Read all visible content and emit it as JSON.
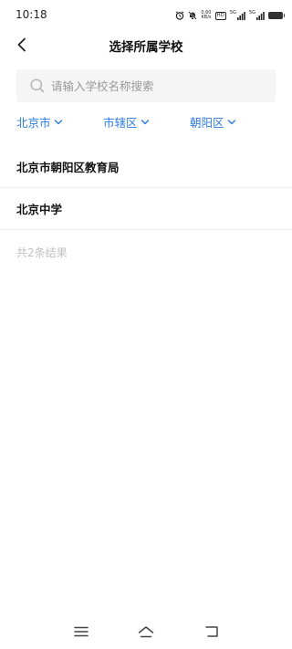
{
  "status_bar": {
    "time": "10:18",
    "net_speed_value": "0.60",
    "net_speed_unit": "KB/s",
    "hd_label": "HD",
    "signal1_label": "5G",
    "signal2_label": "5G",
    "icons": [
      "alarm-icon",
      "mute-icon",
      "hd-icon",
      "signal-icon",
      "signal-icon",
      "battery-icon"
    ]
  },
  "header": {
    "back_icon": "chevron-left-icon",
    "title": "选择所属学校"
  },
  "search": {
    "icon": "search-icon",
    "placeholder": "请输入学校名称搜索",
    "value": ""
  },
  "filters": {
    "city": "北京市",
    "district_type": "市辖区",
    "district": "朝阳区",
    "accent_color": "#2f7de1"
  },
  "results": {
    "items": [
      {
        "name": "北京市朝阳区教育局"
      },
      {
        "name": "北京中学"
      }
    ],
    "count_text": "共2条结果"
  },
  "system_nav": {
    "icons": [
      "menu-icon",
      "home-icon",
      "back-icon"
    ]
  }
}
